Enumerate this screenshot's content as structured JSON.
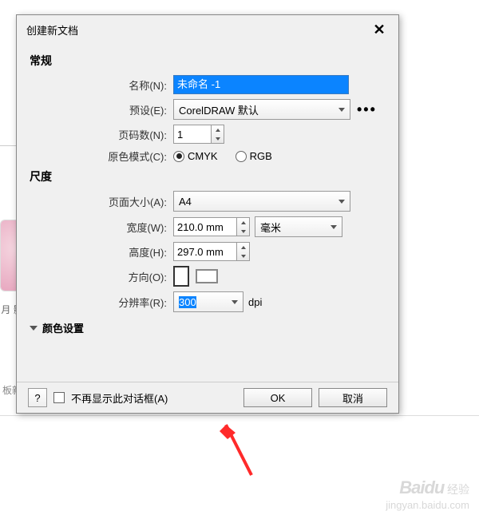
{
  "dialog": {
    "title": "创建新文档",
    "close": "✕"
  },
  "general": {
    "header": "常规",
    "name_label": "名称(N):",
    "name_value": "未命名 -1",
    "preset_label": "预设(E):",
    "preset_value": "CorelDRAW 默认",
    "preset_more": "•••",
    "pages_label": "页码数(N):",
    "pages_value": "1",
    "color_mode_label": "原色模式(C):",
    "cmyk": "CMYK",
    "rgb": "RGB"
  },
  "size": {
    "header": "尺度",
    "page_size_label": "页面大小(A):",
    "page_size_value": "A4",
    "width_label": "宽度(W):",
    "width_value": "210.0 mm",
    "unit_value": "毫米",
    "height_label": "高度(H):",
    "height_value": "297.0 mm",
    "orient_label": "方向(O):",
    "res_label": "分辨率(R):",
    "res_value": "300",
    "res_unit": "dpi"
  },
  "color_section": {
    "header": "颜色设置"
  },
  "footer": {
    "help": "?",
    "dont_show": "不再显示此对话框(A)",
    "ok": "OK",
    "cancel": "取消"
  },
  "bg": {
    "t1": "月\n影",
    "t2": "板新"
  },
  "watermark": {
    "logo": "Baidu",
    "sub": "经验",
    "url": "jingyan.baidu.com"
  }
}
